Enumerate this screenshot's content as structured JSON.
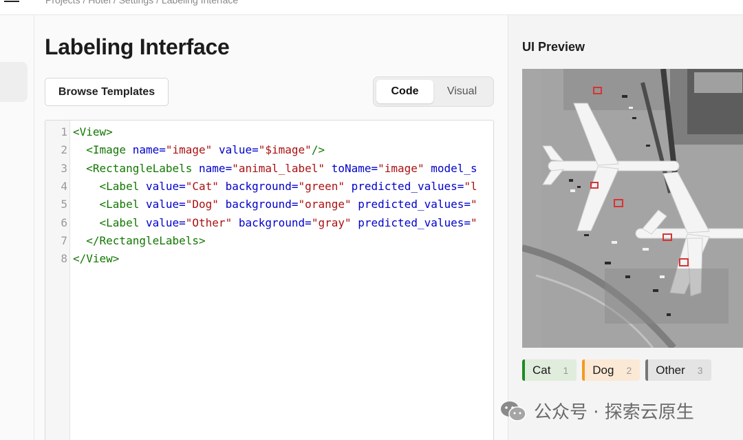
{
  "breadcrumb": "Projects / Hotel / Settings / Labeling Interface",
  "main": {
    "title": "Labeling Interface",
    "browse_label": "Browse Templates",
    "tabs": [
      {
        "label": "Code",
        "active": true
      },
      {
        "label": "Visual",
        "active": false
      }
    ]
  },
  "code_lines": [
    {
      "n": "1",
      "tokens": [
        [
          "t",
          "<View>"
        ]
      ]
    },
    {
      "n": "2",
      "tokens": [
        [
          "p",
          "  "
        ],
        [
          "t",
          "<Image "
        ],
        [
          "a",
          "name="
        ],
        [
          "s",
          "\"image\""
        ],
        [
          "p",
          " "
        ],
        [
          "a",
          "value="
        ],
        [
          "s",
          "\"$image\""
        ],
        [
          "t",
          "/>"
        ]
      ]
    },
    {
      "n": "3",
      "tokens": [
        [
          "p",
          "  "
        ],
        [
          "t",
          "<RectangleLabels "
        ],
        [
          "a",
          "name="
        ],
        [
          "s",
          "\"animal_label\""
        ],
        [
          "p",
          " "
        ],
        [
          "a",
          "toName="
        ],
        [
          "s",
          "\"image\""
        ],
        [
          "p",
          " "
        ],
        [
          "a",
          "model_s"
        ]
      ]
    },
    {
      "n": "4",
      "tokens": [
        [
          "p",
          "    "
        ],
        [
          "t",
          "<Label "
        ],
        [
          "a",
          "value="
        ],
        [
          "s",
          "\"Cat\""
        ],
        [
          "p",
          " "
        ],
        [
          "a",
          "background="
        ],
        [
          "s",
          "\"green\""
        ],
        [
          "p",
          " "
        ],
        [
          "a",
          "predicted_values="
        ],
        [
          "s",
          "\"l"
        ]
      ]
    },
    {
      "n": "5",
      "tokens": [
        [
          "p",
          "    "
        ],
        [
          "t",
          "<Label "
        ],
        [
          "a",
          "value="
        ],
        [
          "s",
          "\"Dog\""
        ],
        [
          "p",
          " "
        ],
        [
          "a",
          "background="
        ],
        [
          "s",
          "\"orange\""
        ],
        [
          "p",
          " "
        ],
        [
          "a",
          "predicted_values="
        ],
        [
          "s",
          "\""
        ]
      ]
    },
    {
      "n": "6",
      "tokens": [
        [
          "p",
          "    "
        ],
        [
          "t",
          "<Label "
        ],
        [
          "a",
          "value="
        ],
        [
          "s",
          "\"Other\""
        ],
        [
          "p",
          " "
        ],
        [
          "a",
          "background="
        ],
        [
          "s",
          "\"gray\""
        ],
        [
          "p",
          " "
        ],
        [
          "a",
          "predicted_values="
        ],
        [
          "s",
          "\""
        ]
      ]
    },
    {
      "n": "7",
      "tokens": [
        [
          "p",
          "  "
        ],
        [
          "t",
          "</RectangleLabels>"
        ]
      ]
    },
    {
      "n": "8",
      "tokens": [
        [
          "t",
          "</View>"
        ]
      ]
    }
  ],
  "preview": {
    "title": "UI Preview",
    "labels": [
      {
        "name": "Cat",
        "hotkey": "1",
        "color": "#1f8a1f"
      },
      {
        "name": "Dog",
        "hotkey": "2",
        "color": "#f39a23"
      },
      {
        "name": "Other",
        "hotkey": "3",
        "color": "#777777"
      }
    ]
  },
  "watermark": "公众号 · 探索云原生"
}
